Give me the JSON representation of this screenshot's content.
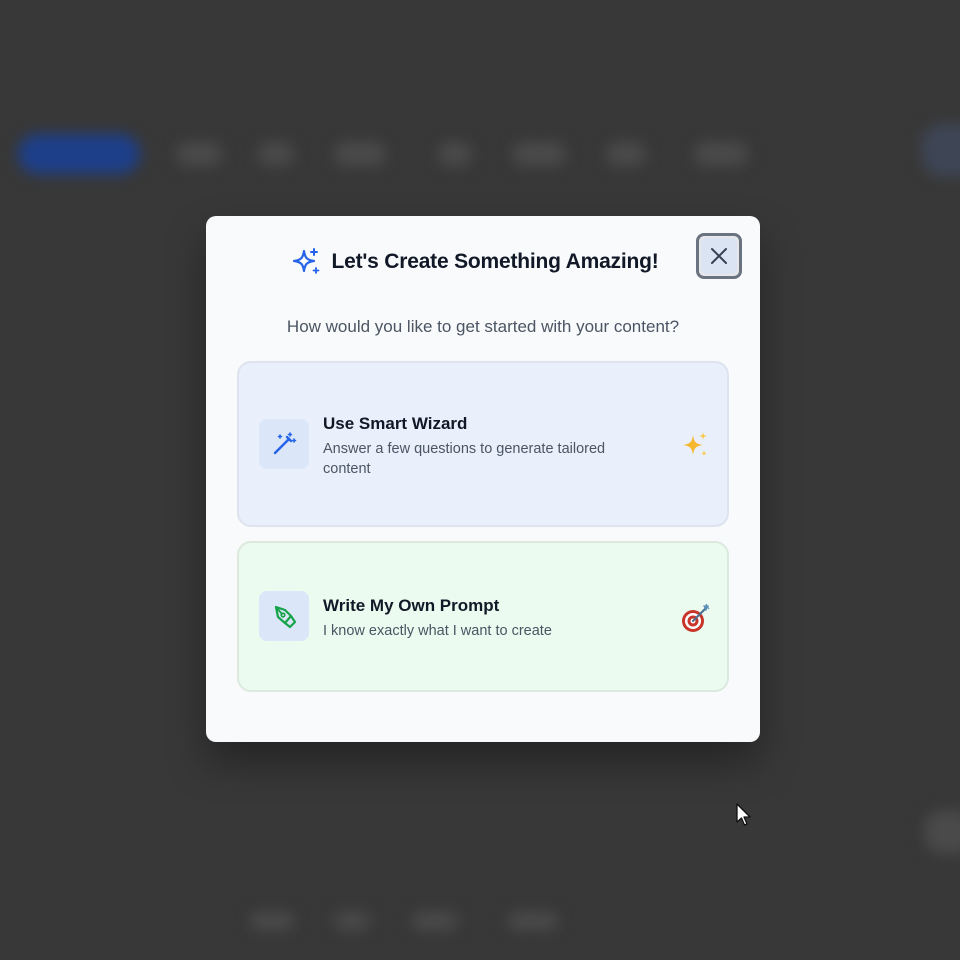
{
  "modal": {
    "title": "Let's Create Something Amazing!",
    "subtitle": "How would you like to get started with your content?",
    "header_icon": "sparkles-icon",
    "close_icon": "close-icon"
  },
  "options": [
    {
      "title": "Use Smart Wizard",
      "description": "Answer a few questions to generate tailored content",
      "icon": "magic-wand-icon",
      "emoji_icon": "sparkles-emoji-icon",
      "icon_color": "#2563eb"
    },
    {
      "title": "Write My Own Prompt",
      "description": "I know exactly what I want to create",
      "icon": "pen-tool-icon",
      "emoji_icon": "target-emoji-icon",
      "icon_color": "#16a34a"
    }
  ],
  "colors": {
    "accent_blue": "#2563eb",
    "accent_green": "#16a34a",
    "wizard_bg": "#e9f0fb",
    "prompt_bg": "#ebfbef"
  }
}
